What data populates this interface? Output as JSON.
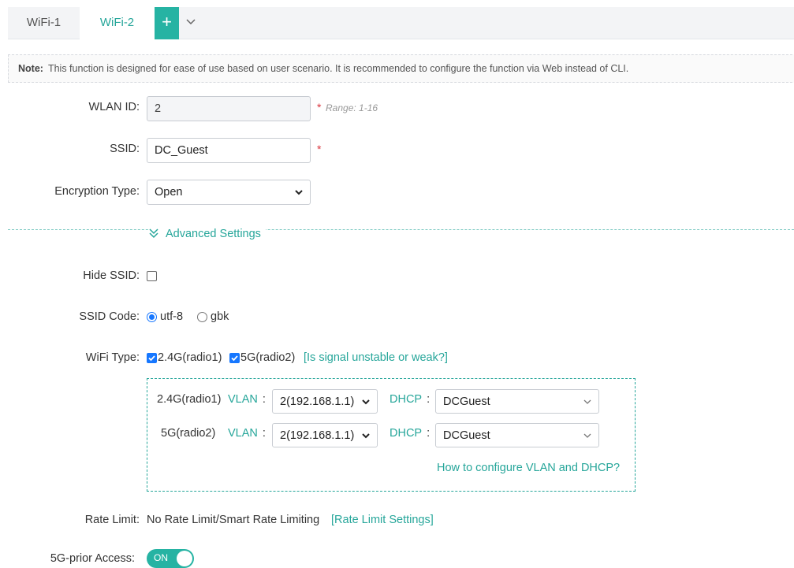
{
  "tabs": {
    "items": [
      {
        "label": "WiFi-1"
      },
      {
        "label": "WiFi-2"
      }
    ],
    "add_label": "+"
  },
  "note": {
    "prefix": "Note:",
    "text": "This function is designed for ease of use based on user scenario. It is recommended to configure the function via Web instead of CLI."
  },
  "form": {
    "wlan_id": {
      "label": "WLAN ID:",
      "value": "2",
      "required": "*",
      "hint": "Range: 1-16"
    },
    "ssid": {
      "label": "SSID:",
      "value": "DC_Guest",
      "required": "*"
    },
    "encryption": {
      "label": "Encryption Type:",
      "value": "Open"
    }
  },
  "advanced": {
    "toggle_label": "Advanced Settings",
    "hide_ssid": {
      "label": "Hide SSID:",
      "checked": false
    },
    "ssid_code": {
      "label": "SSID Code:",
      "options": [
        "utf-8",
        "gbk"
      ],
      "selected": "utf-8"
    },
    "wifi_type": {
      "label": "WiFi Type:",
      "options": [
        {
          "label": "2.4G(radio1)",
          "checked": true
        },
        {
          "label": "5G(radio2)",
          "checked": true
        }
      ],
      "help_link": "[Is signal unstable or weak?]"
    },
    "radios": [
      {
        "name": "2.4G(radio1)",
        "vlan_label": "VLAN",
        "vlan_value": "2(192.168.1.1)",
        "dhcp_label": "DHCP",
        "dhcp_value": "DCGuest"
      },
      {
        "name": "5G(radio2)",
        "vlan_label": "VLAN",
        "vlan_value": "2(192.168.1.1)",
        "dhcp_label": "DHCP",
        "dhcp_value": "DCGuest"
      }
    ],
    "colon": ":",
    "vlan_help": "How to configure VLAN and DHCP?",
    "rate_limit": {
      "label": "Rate Limit:",
      "value": "No Rate Limit/Smart Rate Limiting",
      "link": "[Rate Limit Settings]"
    },
    "next_row": {
      "label": "5G-prior Access:",
      "toggle": "ON"
    }
  },
  "colors": {
    "accent": "#26a69a",
    "required": "#d9363e",
    "checkbox": "#1677ff"
  }
}
